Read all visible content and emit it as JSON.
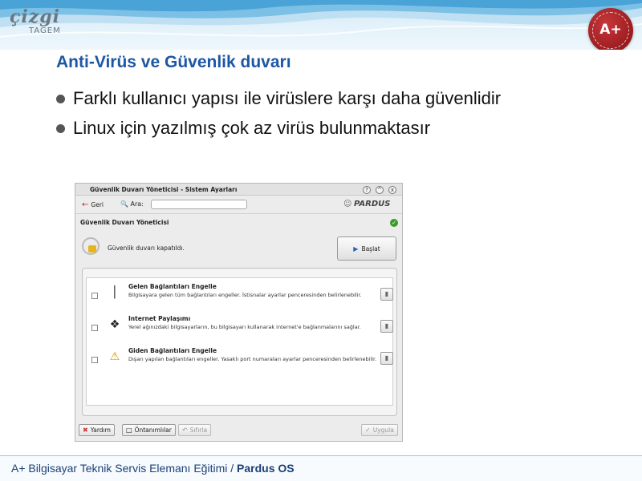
{
  "slide": {
    "logo": {
      "main": "çizgi",
      "sub": "TAGEM"
    },
    "seal_text": "A+",
    "title": "Anti-Virüs ve Güvenlik duvarı",
    "bullets": [
      "Farklı kullanıcı yapısı ile virüslere karşı daha güvenlidir",
      "Linux için yazılmış çok az virüs bulunmaktasır"
    ],
    "footer": {
      "text": "A+ Bilgisayar Teknik Servis Elemanı Eğitimi / ",
      "bold": "Pardus OS"
    },
    "colors": {
      "title": "#1c57a5",
      "footer_text": "#1b3f78",
      "header_wave": "#4aa3d6",
      "seal": "#b02a2d"
    }
  },
  "window": {
    "title": "Güvenlik Duvarı Yöneticisi - Sistem Ayarları",
    "controls": [
      "?",
      "^",
      "x"
    ],
    "toolbar": {
      "back": "Geri",
      "search_label": "Ara:",
      "search_value": ""
    },
    "brand": "PARDUS",
    "module_title": "Güvenlik Duvarı Yöneticisi",
    "status_text": "Güvenlik duvarı kapatıldı.",
    "start_button": "Başlat",
    "rules": [
      {
        "title": "Gelen Bağlantıları Engelle",
        "description": "Bilgisayara gelen tüm bağlantıları engeller. İstisnalar ayarlar penceresinden belirlenebilir.",
        "icon": "thermometer-icon",
        "checked": false
      },
      {
        "title": "Internet Paylaşımı",
        "description": "Yerel ağınızdaki bilgisayarların, bu bilgisayarı kullanarak internet'e bağlanmalarını sağlar.",
        "icon": "windows-icon",
        "checked": false
      },
      {
        "title": "Giden Bağlantıları Engelle",
        "description": "Dışarı yapılan bağlantıları engeller. Yasaklı port numaraları ayarlar penceresinden belirlenebilir.",
        "icon": "shield-warning-icon",
        "checked": false
      }
    ],
    "bottom": {
      "help": "Yardım",
      "defaults": "Öntanımlılar",
      "reset": "Sıfırla",
      "apply": "Uygula"
    }
  }
}
